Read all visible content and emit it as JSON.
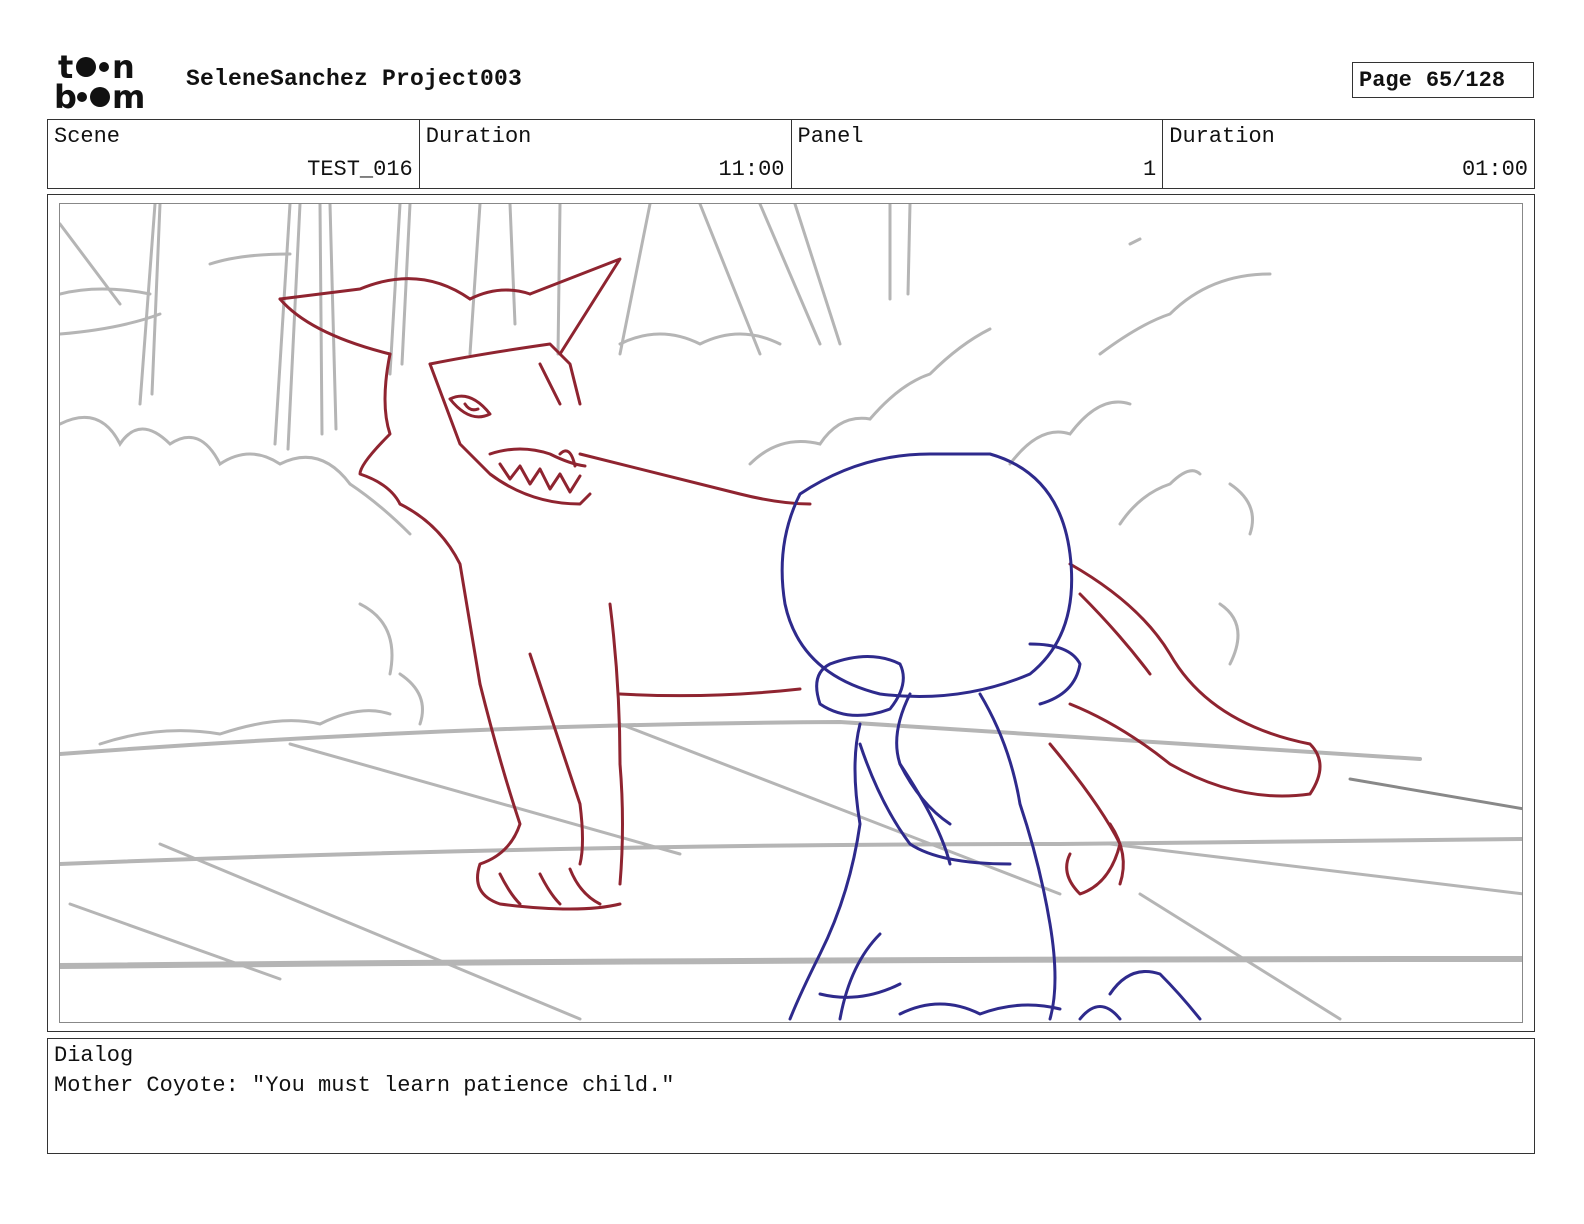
{
  "header": {
    "logo_top": "t••n",
    "logo_bottom": "b••m",
    "project_title": "SeleneSanchez Project003",
    "page_label": "Page",
    "page_value": "65/128"
  },
  "info": {
    "scene_label": "Scene",
    "scene_value": "TEST_016",
    "scene_duration_label": "Duration",
    "scene_duration_value": "11:00",
    "panel_label": "Panel",
    "panel_value": "1",
    "panel_duration_label": "Duration",
    "panel_duration_value": "01:00"
  },
  "panel": {
    "colors": {
      "background_sketch": "#b5b5b5",
      "coyote": "#8f2430",
      "child": "#2e2a8c"
    }
  },
  "dialog": {
    "label": "Dialog",
    "text": "Mother Coyote: \"You must learn patience child.\""
  }
}
